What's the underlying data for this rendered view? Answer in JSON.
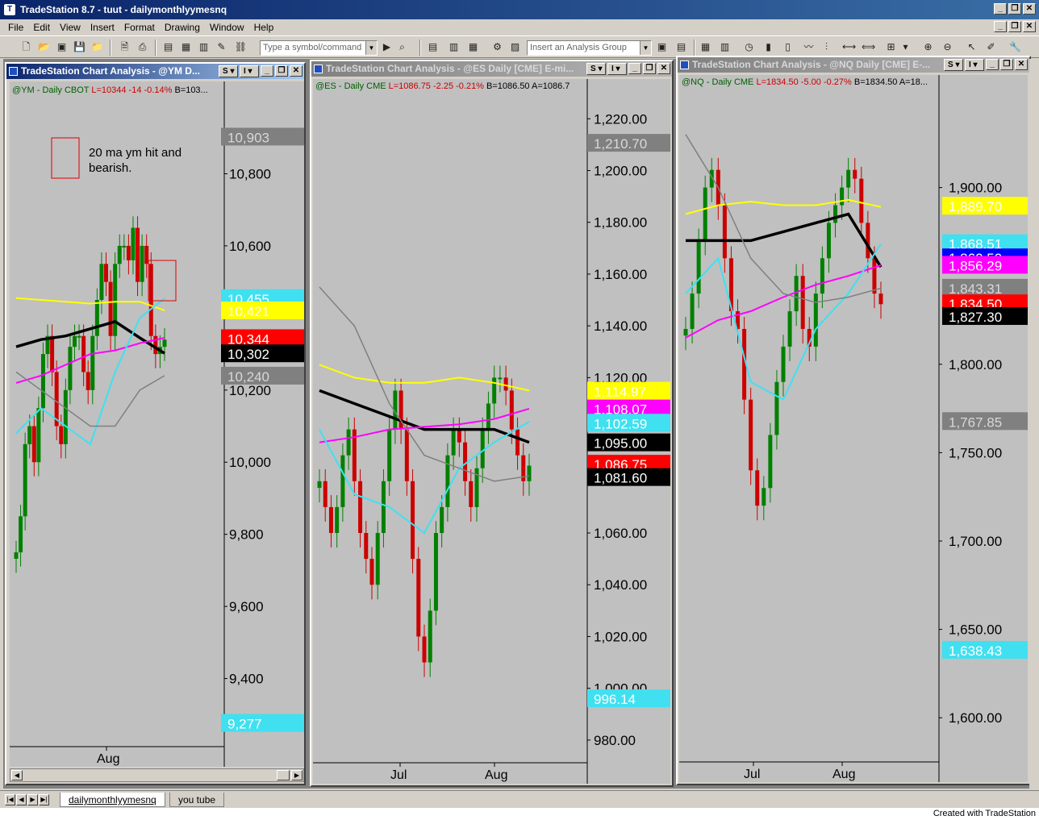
{
  "app": {
    "title": "TradeStation 8.7 - tuut - dailymonthlyymesnq",
    "status": "Created with TradeStation"
  },
  "menu": [
    "File",
    "Edit",
    "View",
    "Insert",
    "Format",
    "Drawing",
    "Window",
    "Help"
  ],
  "toolbar": {
    "symbol_placeholder": "Type a symbol/command",
    "analysis_placeholder": "Insert an Analysis Group"
  },
  "tabs": [
    "dailymonthlyymesnq",
    "you tube"
  ],
  "colors": {
    "up": "#008000",
    "down": "#cc0000",
    "ma_yellow": "#ffff00",
    "ma_cyan": "#40e0f0",
    "ma_magenta": "#ff00ff",
    "ma_black": "#000000",
    "ma_gray": "#808080"
  },
  "charts": [
    {
      "title": "TradeStation Chart Analysis - @YM D...",
      "status": {
        "symbol": "@YM - Daily  CBOT",
        "last": "L=10344  -14  -0.14%",
        "extra": "B=103..."
      },
      "annotation": {
        "line1": "20 ma ym hit and",
        "line2": "bearish."
      },
      "x_label": "Aug",
      "scrollbar": true
    },
    {
      "title": "TradeStation Chart Analysis - @ES Daily [CME] E-mi...",
      "status": {
        "symbol": "@ES - Daily  CME",
        "last": "L=1086.75  -2.25  -0.21%",
        "extra": "B=1086.50  A=1086.7"
      },
      "x_labels": [
        "Jul",
        "Aug"
      ]
    },
    {
      "title": "TradeStation Chart Analysis - @NQ Daily [CME] E-...",
      "status": {
        "symbol": "@NQ - Daily  CME",
        "last": "L=1834.50  -5.00  -0.27%",
        "extra": "B=1834.50  A=18..."
      },
      "x_labels": [
        "Jul",
        "Aug"
      ]
    }
  ],
  "chart_data": [
    {
      "type": "candlestick",
      "symbol": "@YM",
      "y_ticks": [
        "10,800",
        "10,600",
        "10,200",
        "10,000",
        "9,800",
        "9,600",
        "9,400"
      ],
      "ylim": [
        9200,
        10980
      ],
      "price_tags": [
        {
          "label": "10,903",
          "bg": "#808080",
          "fg": "#d8d8d8"
        },
        {
          "label": "10,455",
          "bg": "#40e0f0",
          "fg": "#fff"
        },
        {
          "label": "10,421",
          "bg": "#ffff00",
          "fg": "#fff"
        },
        {
          "label": "10,344",
          "bg": "#ff0000",
          "fg": "#fff"
        },
        {
          "label": "10,302",
          "bg": "#000000",
          "fg": "#fff"
        },
        {
          "label": "10,240",
          "bg": "#808080",
          "fg": "#d8d8d8"
        },
        {
          "label": "9,277",
          "bg": "#40e0f0",
          "fg": "#fff"
        }
      ],
      "closes": [
        9750,
        9850,
        10050,
        10100,
        10000,
        10150,
        10300,
        10350,
        10250,
        10100,
        10050,
        10200,
        10320,
        10350,
        10350,
        10250,
        10200,
        10350,
        10450,
        10550,
        10500,
        10350,
        10550,
        10600,
        10600,
        10560,
        10650,
        10500,
        10600,
        10550,
        10350,
        10300,
        10320,
        10340
      ],
      "overlays": {
        "black_ma": [
          10320,
          10340,
          10350,
          10370,
          10390,
          10345,
          10302
        ],
        "magenta_ma": [
          10220,
          10240,
          10270,
          10300,
          10310,
          10330,
          10345
        ],
        "yellow_ma": [
          10455,
          10450,
          10445,
          10440,
          10445,
          10445,
          10421
        ],
        "cyan_ma": [
          10080,
          10150,
          10100,
          10050,
          10250,
          10400,
          10455
        ],
        "gray_ma": [
          10250,
          10200,
          10150,
          10100,
          10100,
          10200,
          10240
        ]
      }
    },
    {
      "type": "candlestick",
      "symbol": "@ES",
      "y_ticks": [
        "1,220.00",
        "1,200.00",
        "1,180.00",
        "1,160.00",
        "1,140.00",
        "1,120.00",
        "1,060.00",
        "1,040.00",
        "1,020.00",
        "1,000.00",
        "980.00"
      ],
      "ylim": [
        970,
        1226
      ],
      "price_tags": [
        {
          "label": "1,210.70",
          "bg": "#808080",
          "fg": "#d8d8d8"
        },
        {
          "label": "1,114.97",
          "bg": "#ffff00",
          "fg": "#fff"
        },
        {
          "label": "1,108.07",
          "bg": "#ff00ff",
          "fg": "#fff"
        },
        {
          "label": "1,102.59",
          "bg": "#40e0f0",
          "fg": "#fff"
        },
        {
          "label": "1,095.00",
          "bg": "#000000",
          "fg": "#fff"
        },
        {
          "label": "1,086.75",
          "bg": "#ff0000",
          "fg": "#fff"
        },
        {
          "label": "1,081.60",
          "bg": "#000000",
          "fg": "#fff"
        },
        {
          "label": "996.14",
          "bg": "#40e0f0",
          "fg": "#fff"
        }
      ],
      "closes": [
        1080,
        1070,
        1060,
        1070,
        1090,
        1100,
        1080,
        1060,
        1050,
        1040,
        1060,
        1080,
        1100,
        1115,
        1100,
        1080,
        1050,
        1020,
        1010,
        1030,
        1060,
        1070,
        1090,
        1100,
        1095,
        1080,
        1070,
        1085,
        1100,
        1110,
        1120,
        1120,
        1115,
        1100,
        1090,
        1080,
        1086
      ],
      "overlays": {
        "black_ma": [
          1115,
          1110,
          1105,
          1100,
          1100,
          1100,
          1095
        ],
        "magenta_ma": [
          1095,
          1097,
          1100,
          1101,
          1102,
          1104,
          1108
        ],
        "yellow_ma": [
          1125,
          1120,
          1118,
          1118,
          1120,
          1118,
          1115
        ],
        "cyan_ma": [
          1100,
          1075,
          1070,
          1060,
          1085,
          1095,
          1103
        ],
        "gray_ma": [
          1155,
          1140,
          1110,
          1090,
          1085,
          1080,
          1082
        ]
      }
    },
    {
      "type": "candlestick",
      "symbol": "@NQ",
      "y_ticks": [
        "1,900.00",
        "1,800.00",
        "1,750.00",
        "1,700.00",
        "1,650.00",
        "1,600.00"
      ],
      "ylim": [
        1575,
        1950
      ],
      "price_tags": [
        {
          "label": "1,889.70",
          "bg": "#ffff00",
          "fg": "#fff"
        },
        {
          "label": "1,868.51",
          "bg": "#40e0f0",
          "fg": "#fff"
        },
        {
          "label": "1,860.50",
          "bg": "#0000ff",
          "fg": "#fff"
        },
        {
          "label": "1,856.29",
          "bg": "#ff00ff",
          "fg": "#fff"
        },
        {
          "label": "1,843.31",
          "bg": "#808080",
          "fg": "#d8d8d8"
        },
        {
          "label": "1,834.50",
          "bg": "#ff0000",
          "fg": "#fff"
        },
        {
          "label": "1,827.30",
          "bg": "#000000",
          "fg": "#fff"
        },
        {
          "label": "1,767.85",
          "bg": "#808080",
          "fg": "#d8d8d8"
        },
        {
          "label": "1,638.43",
          "bg": "#40e0f0",
          "fg": "#fff"
        }
      ],
      "closes": [
        1820,
        1840,
        1870,
        1900,
        1910,
        1890,
        1860,
        1830,
        1820,
        1780,
        1740,
        1720,
        1730,
        1760,
        1790,
        1810,
        1830,
        1850,
        1820,
        1810,
        1840,
        1860,
        1880,
        1890,
        1900,
        1910,
        1905,
        1880,
        1860,
        1840,
        1834
      ],
      "overlays": {
        "black_ma": [
          1870,
          1870,
          1870,
          1875,
          1880,
          1885,
          1855
        ],
        "magenta_ma": [
          1815,
          1825,
          1830,
          1838,
          1845,
          1850,
          1856
        ],
        "yellow_ma": [
          1885,
          1890,
          1892,
          1890,
          1890,
          1893,
          1889
        ],
        "cyan_ma": [
          1840,
          1860,
          1790,
          1780,
          1820,
          1840,
          1868
        ],
        "gray_ma": [
          1930,
          1900,
          1860,
          1840,
          1835,
          1838,
          1843
        ]
      }
    }
  ]
}
